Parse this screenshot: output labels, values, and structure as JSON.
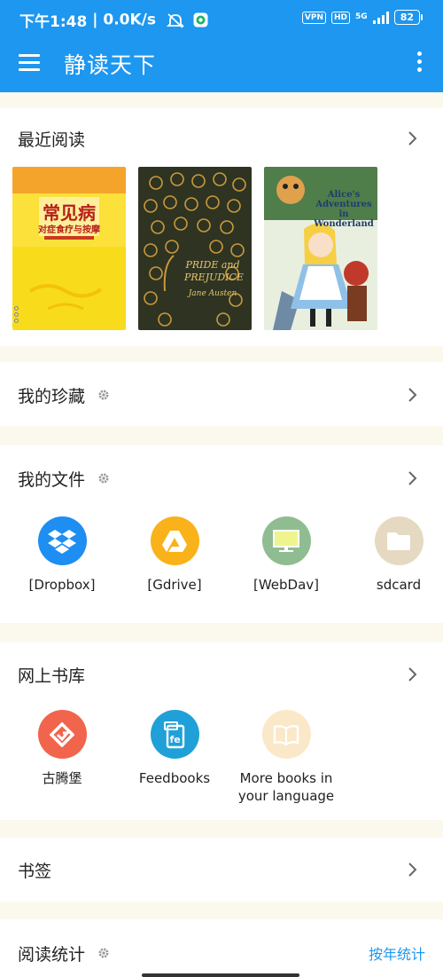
{
  "status_bar": {
    "time": "下午1:48",
    "net_speed": "0.0K/s",
    "vpn": "VPN",
    "hd": "HD",
    "network": "5G",
    "battery": "82"
  },
  "app_bar": {
    "title": "静读天下"
  },
  "sections": {
    "recent": {
      "title": "最近阅读",
      "books": [
        {
          "title": "常见病",
          "subtitle": "对症食疗与按摩",
          "cover_color": "#f7d31a"
        },
        {
          "title": "PRIDE and PREJUDICE",
          "author": "Jane Austen",
          "cover_color": "#3a3a24"
        },
        {
          "title": "Alice's Adventures in Wonderland",
          "cover_color": "#eef2e4"
        }
      ]
    },
    "favorites": {
      "title": "我的珍藏"
    },
    "files": {
      "title": "我的文件",
      "items": [
        {
          "label": "[Dropbox]",
          "icon": "dropbox-icon",
          "color": "#1e8ef2"
        },
        {
          "label": "[Gdrive]",
          "icon": "google-drive-icon",
          "color": "#f9b21a"
        },
        {
          "label": "[WebDav]",
          "icon": "monitor-icon",
          "color": "#8fbd91"
        },
        {
          "label": "sdcard",
          "icon": "folder-icon",
          "color": "#e5d9c2"
        }
      ]
    },
    "online": {
      "title": "网上书库",
      "items": [
        {
          "label": "古腾堡",
          "icon": "gutenberg-icon",
          "color": "#f1654d"
        },
        {
          "label": "Feedbooks",
          "icon": "feedbooks-icon",
          "color": "#1fa0d8"
        },
        {
          "label_line1": "More books in",
          "label_line2": "your language",
          "icon": "open-book-icon",
          "color": "#fbe8c8"
        }
      ]
    },
    "bookmarks": {
      "title": "书签"
    },
    "stats": {
      "title": "阅读统计",
      "link": "按年统计"
    }
  }
}
